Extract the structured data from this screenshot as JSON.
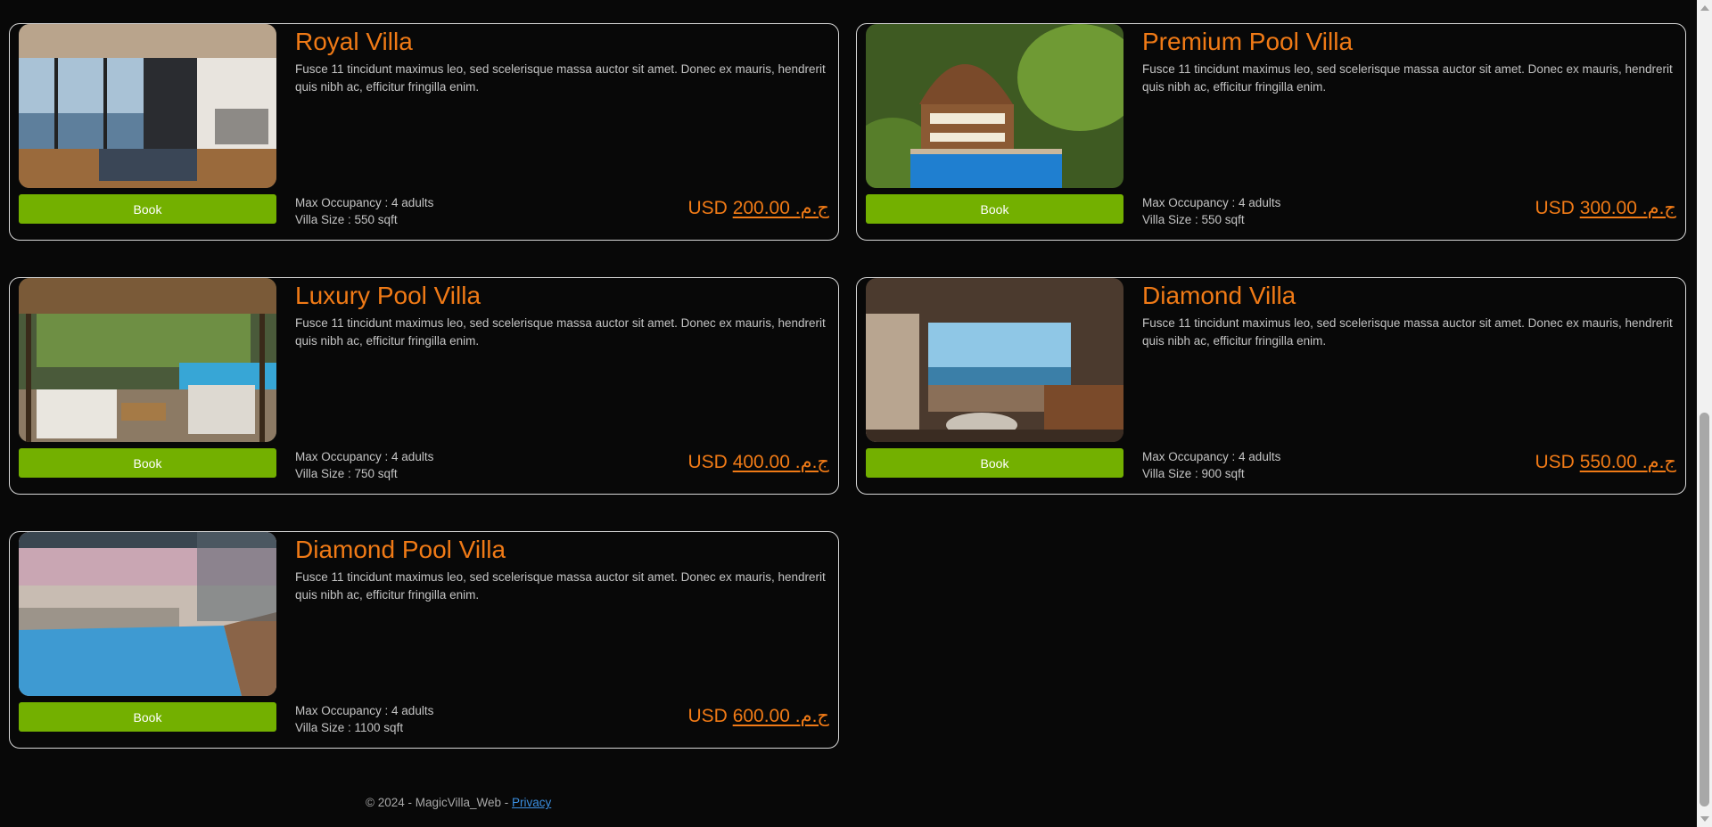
{
  "book_label": "Book",
  "currency": "USD",
  "villas": [
    {
      "name": "Royal Villa",
      "description": "Fusce 11 tincidunt maximus leo, sed scelerisque massa auctor sit amet. Donec ex mauris, hendrerit quis nibh ac, efficitur fringilla enim.",
      "occupancy": "Max Occupancy : 4 adults",
      "size": "Villa Size : 550 sqft",
      "price": "200.00 .ج.م"
    },
    {
      "name": "Premium Pool Villa",
      "description": "Fusce 11 tincidunt maximus leo, sed scelerisque massa auctor sit amet. Donec ex mauris, hendrerit quis nibh ac, efficitur fringilla enim.",
      "occupancy": "Max Occupancy : 4 adults",
      "size": "Villa Size : 550 sqft",
      "price": "300.00 .ج.م"
    },
    {
      "name": "Luxury Pool Villa",
      "description": "Fusce 11 tincidunt maximus leo, sed scelerisque massa auctor sit amet. Donec ex mauris, hendrerit quis nibh ac, efficitur fringilla enim.",
      "occupancy": "Max Occupancy : 4 adults",
      "size": "Villa Size : 750 sqft",
      "price": "400.00 .ج.م"
    },
    {
      "name": "Diamond Villa",
      "description": "Fusce 11 tincidunt maximus leo, sed scelerisque massa auctor sit amet. Donec ex mauris, hendrerit quis nibh ac, efficitur fringilla enim.",
      "occupancy": "Max Occupancy : 4 adults",
      "size": "Villa Size : 900 sqft",
      "price": "550.00 .ج.م"
    },
    {
      "name": "Diamond Pool Villa",
      "description": "Fusce 11 tincidunt maximus leo, sed scelerisque massa auctor sit amet. Donec ex mauris, hendrerit quis nibh ac, efficitur fringilla enim.",
      "occupancy": "Max Occupancy : 4 adults",
      "size": "Villa Size : 1100 sqft",
      "price": "600.00 .ج.م"
    }
  ],
  "footer": {
    "text": "© 2024 - MagicVilla_Web - ",
    "privacy_link": "Privacy"
  },
  "colors": {
    "accent": "#f07a16",
    "button": "#73b000",
    "background": "#080808",
    "border": "#d8d8d8"
  }
}
